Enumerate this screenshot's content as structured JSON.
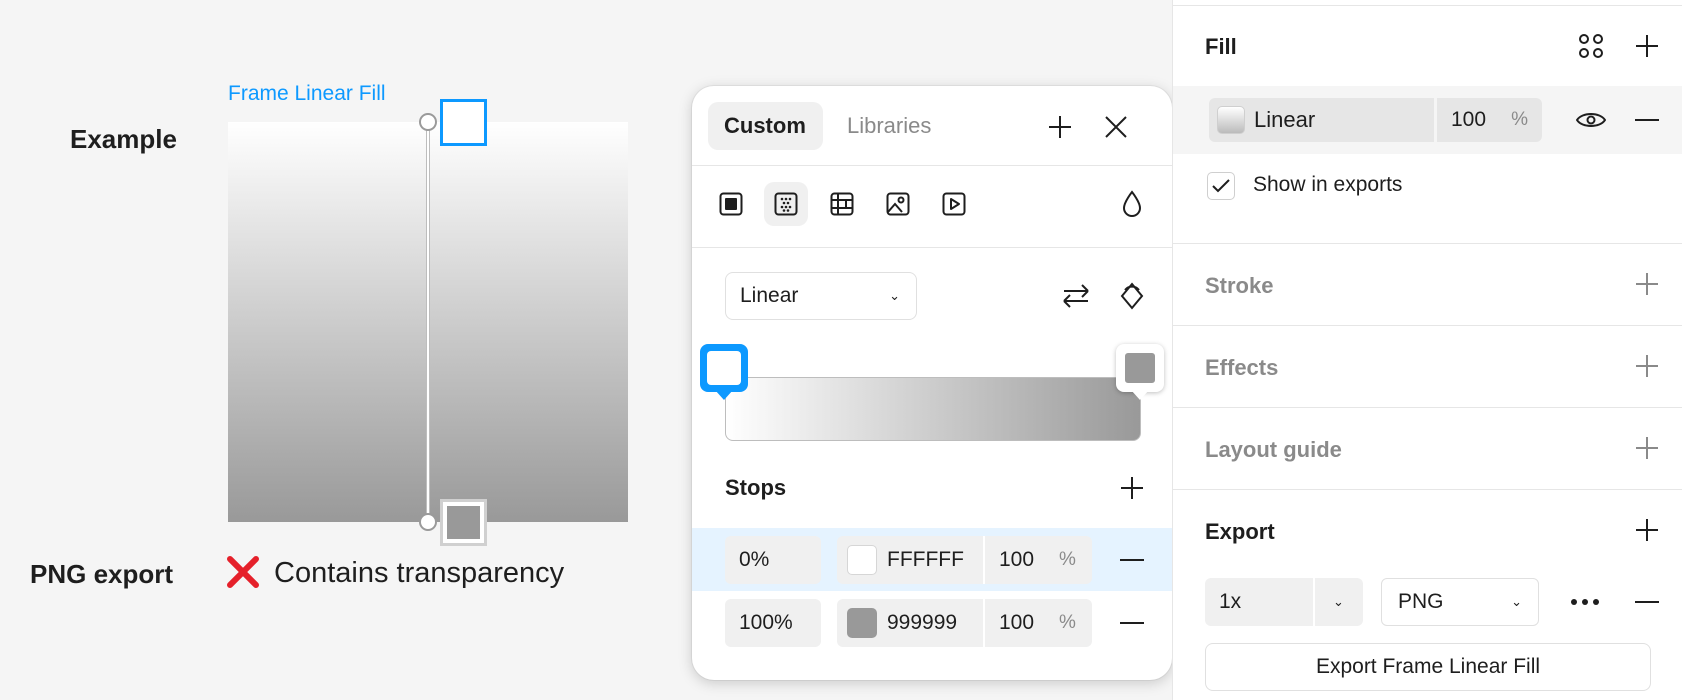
{
  "canvas": {
    "example_label": "Example",
    "frame_name": "Frame Linear Fill",
    "png_label": "PNG export",
    "status_text": "Contains transparency",
    "gradient_colors": [
      "#ffffff",
      "#999999"
    ]
  },
  "picker": {
    "tabs": [
      "Custom",
      "Libraries"
    ],
    "active_tab": "Custom",
    "fill_type_icons": [
      "solid-fill-icon",
      "gradient-fill-icon",
      "pattern-fill-icon",
      "image-fill-icon",
      "video-fill-icon"
    ],
    "gradient_type": "Linear",
    "stops_title": "Stops",
    "stops": [
      {
        "position": "0%",
        "hex": "FFFFFF",
        "opacity": "100",
        "unit": "%",
        "color": "#ffffff"
      },
      {
        "position": "100%",
        "hex": "999999",
        "opacity": "100",
        "unit": "%",
        "color": "#999999"
      }
    ]
  },
  "panel": {
    "fill_title": "Fill",
    "fill_type": "Linear",
    "fill_opacity": "100",
    "fill_unit": "%",
    "show_in_exports": "Show in exports",
    "show_in_exports_checked": true,
    "stroke_title": "Stroke",
    "effects_title": "Effects",
    "layout_guide_title": "Layout guide",
    "export_title": "Export",
    "export_scale": "1x",
    "export_format": "PNG",
    "export_button": "Export Frame Linear Fill"
  },
  "colors": {
    "accent": "#0d99ff",
    "error": "#e5202a",
    "stop_row_highlight": "#e5f3ff"
  }
}
